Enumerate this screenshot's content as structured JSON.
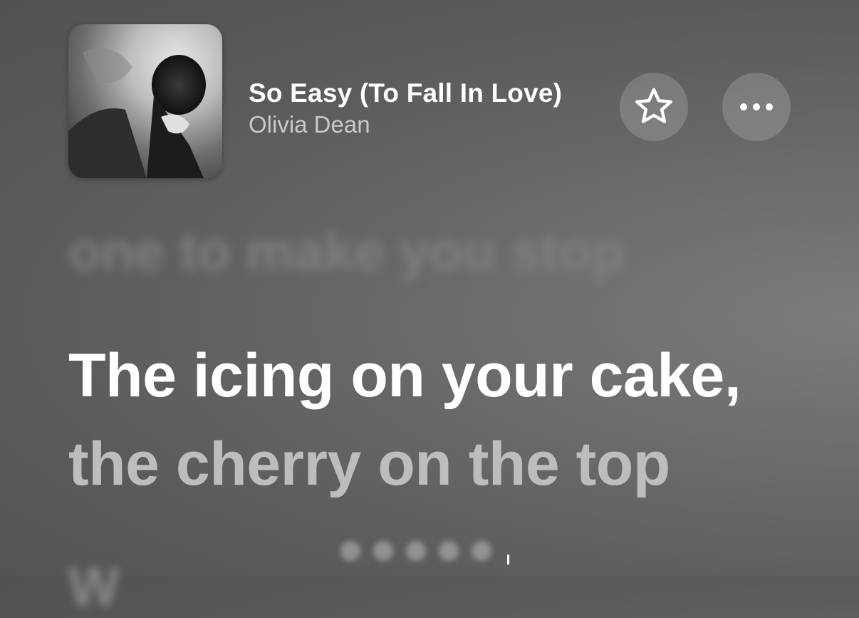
{
  "now_playing": {
    "title": "So Easy (To Fall In Love)",
    "artist": "Olivia Dean",
    "artwork_icon": "album-artwork"
  },
  "actions": {
    "favorite_icon": "star-icon",
    "more_icon": "ellipsis-icon"
  },
  "lyrics": {
    "previous": "one to make you stop",
    "current_line_1": "The icing on your cake,",
    "current_line_2": "the cherry on the top",
    "next": "W"
  },
  "colors": {
    "background": "#5a5a5a",
    "active_lyric": "#ffffff",
    "secondary_text": "#c9c9c9"
  }
}
